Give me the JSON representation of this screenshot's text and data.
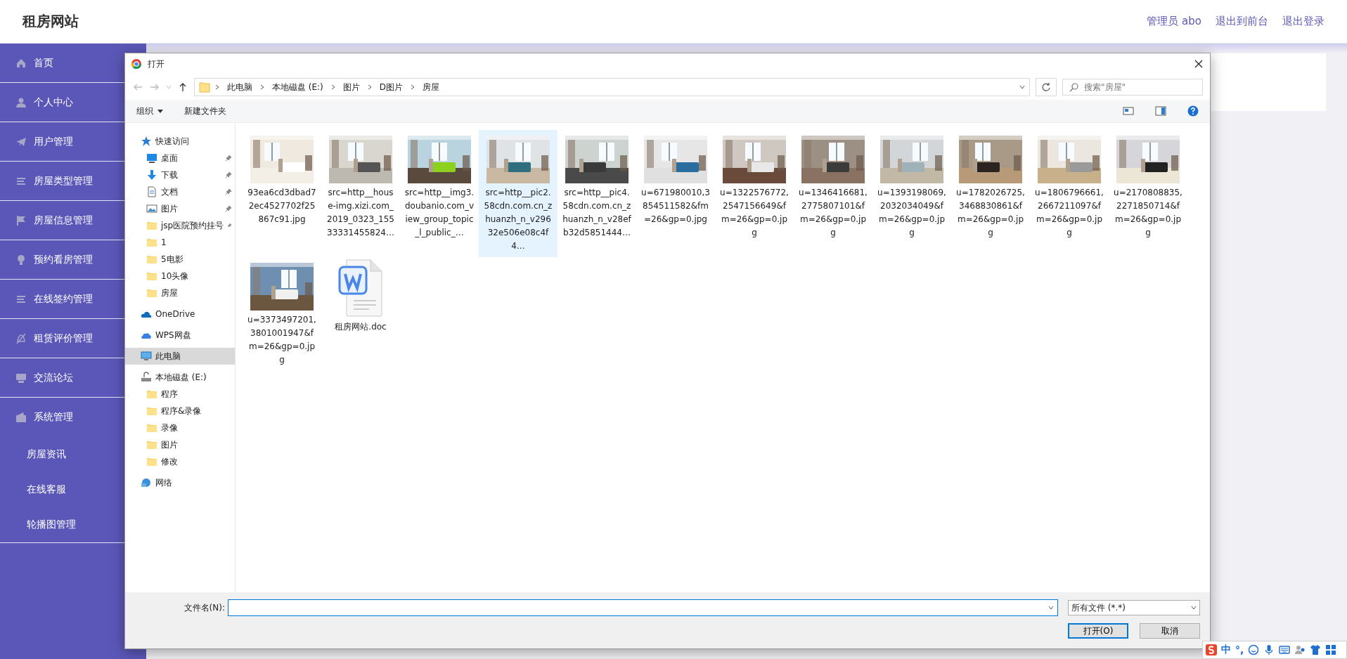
{
  "header": {
    "title": "租房网站",
    "links": [
      "管理员 abo",
      "退出到前台",
      "退出登录"
    ]
  },
  "menu": [
    {
      "label": "首页"
    },
    {
      "label": "个人中心"
    },
    {
      "label": "用户管理"
    },
    {
      "label": "房屋类型管理"
    },
    {
      "label": "房屋信息管理"
    },
    {
      "label": "预约看房管理"
    },
    {
      "label": "在线签约管理"
    },
    {
      "label": "租赁评价管理"
    },
    {
      "label": "交流论坛"
    },
    {
      "label": "系统管理",
      "expanded": true,
      "children": [
        {
          "label": "房屋资讯"
        },
        {
          "label": "在线客服"
        },
        {
          "label": "轮播图管理"
        }
      ]
    }
  ],
  "dialog": {
    "title": "打开",
    "breadcrumbs": [
      "此电脑",
      "本地磁盘 (E:)",
      "图片",
      "D图片",
      "房屋"
    ],
    "search": {
      "placeholder": "搜索\"房屋\""
    },
    "toolbar": [
      "组织",
      "新建文件夹"
    ],
    "nav": [
      {
        "label": "快速访问",
        "kind": "quick",
        "selected": false,
        "children": [
          {
            "label": "桌面",
            "kind": "desktop",
            "pinned": true
          },
          {
            "label": "下载",
            "kind": "download",
            "pinned": true
          },
          {
            "label": "文档",
            "kind": "document",
            "pinned": true
          },
          {
            "label": "图片",
            "kind": "pictures",
            "pinned": true
          },
          {
            "label": "jsp医院预约挂号",
            "kind": "folder",
            "pinned": true
          },
          {
            "label": "1",
            "kind": "folder",
            "pinned": false
          },
          {
            "label": "5电影",
            "kind": "folder",
            "pinned": false
          },
          {
            "label": "10头像",
            "kind": "folder",
            "pinned": false
          },
          {
            "label": "房屋",
            "kind": "folder",
            "pinned": false
          }
        ]
      },
      {
        "label": "OneDrive",
        "kind": "cloud",
        "selected": false
      },
      {
        "label": "WPS网盘",
        "kind": "wps",
        "selected": false
      },
      {
        "label": "此电脑",
        "kind": "pc",
        "selected": true
      },
      {
        "label": "本地磁盘 (E:)",
        "kind": "drive",
        "selected": false,
        "children": [
          {
            "label": "程序",
            "kind": "folder",
            "pinned": false
          },
          {
            "label": "程序&录像",
            "kind": "folder",
            "pinned": false
          },
          {
            "label": "录像",
            "kind": "folder",
            "pinned": false
          },
          {
            "label": "图片",
            "kind": "folder",
            "pinned": false
          },
          {
            "label": "修改",
            "kind": "folder",
            "pinned": false
          }
        ]
      },
      {
        "label": "网络",
        "kind": "network",
        "selected": false
      }
    ],
    "files": [
      {
        "name": "93ea6cd3dbad72ec4527702f25867c91.jpg",
        "kind": "picture",
        "selected": false
      },
      {
        "name": "src=http__house-img.xizi.com_2019_0323_15533331455824…",
        "kind": "picture",
        "selected": false
      },
      {
        "name": "src=http__img3.doubanio.com_view_group_topic_l_public_…",
        "kind": "picture",
        "selected": false
      },
      {
        "name": "src=http__pic2.58cdn.com.cn_zhuanzh_n_v29632e506e08c4f4…",
        "kind": "picture",
        "selected": true
      },
      {
        "name": "src=http__pic4.58cdn.com.cn_zhuanzh_n_v28efb32d5851444…",
        "kind": "picture",
        "selected": false
      },
      {
        "name": "u=671980010,3854511582&fm=26&gp=0.jpg",
        "kind": "picture",
        "selected": false
      },
      {
        "name": "u=1322576772,2547156649&fm=26&gp=0.jpg",
        "kind": "picture",
        "selected": false
      },
      {
        "name": "u=1346416681,2775807101&fm=26&gp=0.jpg",
        "kind": "picture",
        "selected": false
      },
      {
        "name": "u=1393198069,2032034049&fm=26&gp=0.jpg",
        "kind": "picture",
        "selected": false
      },
      {
        "name": "u=1782026725,3468830861&fm=26&gp=0.jpg",
        "kind": "picture",
        "selected": false
      },
      {
        "name": "u=1806796661,2667211097&fm=26&gp=0.jpg",
        "kind": "picture",
        "selected": false
      },
      {
        "name": "u=2170808835,2271850714&fm=26&gp=0.jpg",
        "kind": "picture",
        "selected": false
      },
      {
        "name": "u=3373497201,3801001947&fm=26&gp=0.jpg",
        "kind": "picture",
        "selected": false
      },
      {
        "name": "租房网站.doc",
        "kind": "doc",
        "selected": false
      }
    ],
    "filename": {
      "label": "文件名(N):"
    },
    "filter": "所有文件 (*.*)",
    "buttons": [
      {
        "label": "打开(O)",
        "kind": "primary"
      },
      {
        "label": "取消",
        "kind": "normal"
      }
    ]
  },
  "ime_bar": {
    "mode": "中",
    "punct": "°,"
  }
}
